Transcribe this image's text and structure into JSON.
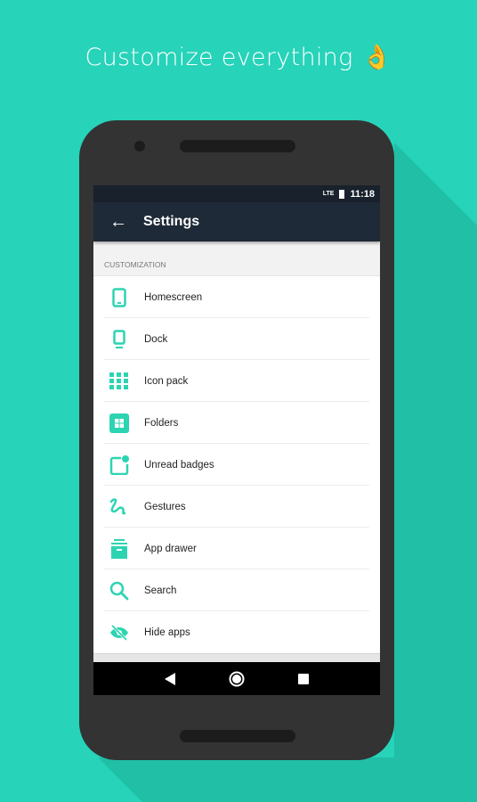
{
  "headline": {
    "text": "Customize everything",
    "emoji": "👌"
  },
  "status_bar": {
    "network": "LTE",
    "time": "11:18"
  },
  "toolbar": {
    "title": "Settings",
    "back_icon": "arrow-left-icon"
  },
  "section": {
    "title": "CUSTOMIZATION"
  },
  "items": [
    {
      "label": "Homescreen",
      "icon": "phone-icon"
    },
    {
      "label": "Dock",
      "icon": "dock-icon"
    },
    {
      "label": "Icon pack",
      "icon": "grid-icon"
    },
    {
      "label": "Folders",
      "icon": "folder-icon"
    },
    {
      "label": "Unread badges",
      "icon": "badge-icon"
    },
    {
      "label": "Gestures",
      "icon": "gesture-icon"
    },
    {
      "label": "App drawer",
      "icon": "drawer-icon"
    },
    {
      "label": "Search",
      "icon": "search-icon"
    },
    {
      "label": "Hide apps",
      "icon": "eye-off-icon"
    }
  ],
  "colors": {
    "background": "#27d3b9",
    "accent": "#2dd4b2",
    "toolbar": "#1f2a38"
  }
}
